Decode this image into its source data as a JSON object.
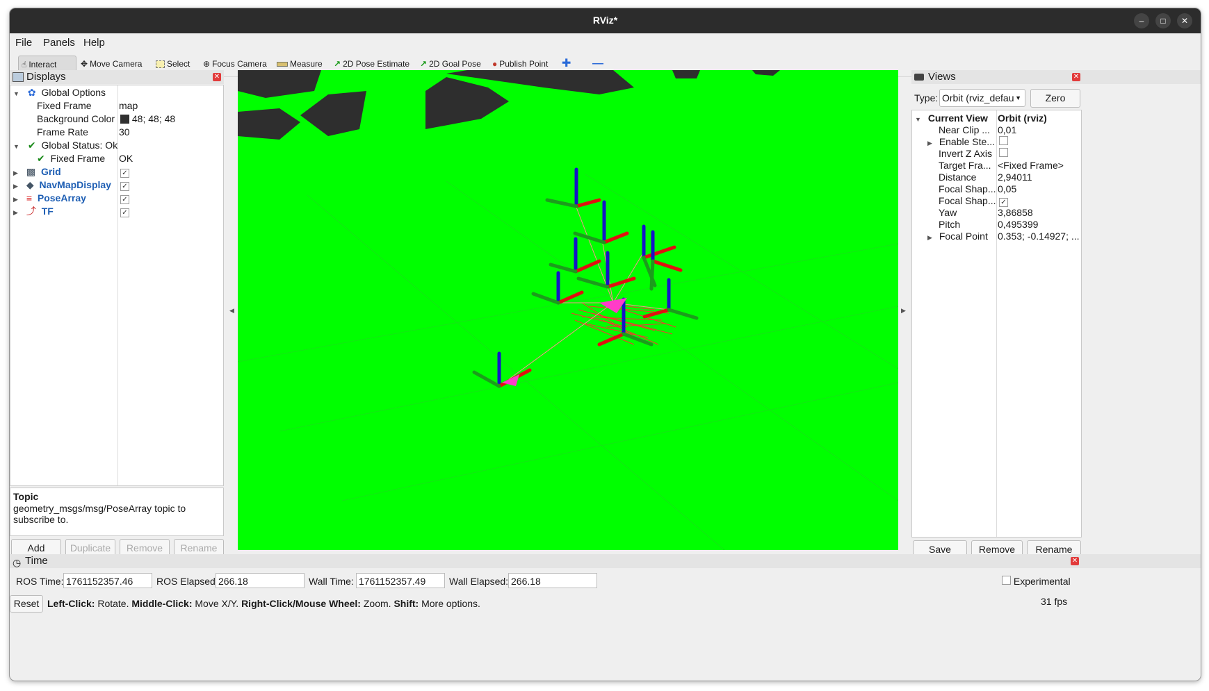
{
  "window": {
    "title": "RViz*"
  },
  "menu": {
    "file": "File",
    "panels": "Panels",
    "help": "Help"
  },
  "toolbar": {
    "interact": "Interact",
    "move_camera": "Move Camera",
    "select": "Select",
    "focus_camera": "Focus Camera",
    "measure": "Measure",
    "pose_estimate": "2D Pose Estimate",
    "goal_pose": "2D Goal Pose",
    "publish_point": "Publish Point"
  },
  "displays": {
    "title": "Displays",
    "global_options": "Global Options",
    "fixed_frame_label": "Fixed Frame",
    "fixed_frame_value": "map",
    "bg_color_label": "Background Color",
    "bg_color_value": "48; 48; 48",
    "frame_rate_label": "Frame Rate",
    "frame_rate_value": "30",
    "global_status": "Global Status: Ok",
    "status_fixed_frame": "Fixed Frame",
    "status_fixed_frame_value": "OK",
    "items": [
      "Grid",
      "NavMapDisplay",
      "PoseArray",
      "TF"
    ],
    "help_title": "Topic",
    "help_text": "geometry_msgs/msg/PoseArray topic to subscribe to.",
    "buttons": {
      "add": "Add",
      "duplicate": "Duplicate",
      "remove": "Remove",
      "rename": "Rename"
    }
  },
  "views": {
    "title": "Views",
    "type_label": "Type:",
    "type_value": "Orbit (rviz_defau",
    "zero": "Zero",
    "current_view": "Current View",
    "current_view_value": "Orbit (rviz)",
    "props": [
      {
        "label": "Near Clip ...",
        "value": "0,01"
      },
      {
        "label": "Enable Ste...",
        "value": ""
      },
      {
        "label": "Invert Z Axis",
        "value": ""
      },
      {
        "label": "Target Fra...",
        "value": "<Fixed Frame>"
      },
      {
        "label": "Distance",
        "value": "2,94011"
      },
      {
        "label": "Focal Shap...",
        "value": "0,05"
      },
      {
        "label": "Focal Shap...",
        "value": ""
      },
      {
        "label": "Yaw",
        "value": "3,86858"
      },
      {
        "label": "Pitch",
        "value": "0,495399"
      },
      {
        "label": "Focal Point",
        "value": "0.353; -0.14927; ..."
      }
    ],
    "buttons": {
      "save": "Save",
      "remove": "Remove",
      "rename": "Rename"
    }
  },
  "time": {
    "title": "Time",
    "ros_time_label": "ROS Time:",
    "ros_time": "1761152357.46",
    "ros_elapsed_label": "ROS Elapsed:",
    "ros_elapsed": "266.18",
    "wall_time_label": "Wall Time:",
    "wall_time": "1761152357.49",
    "wall_elapsed_label": "Wall Elapsed:",
    "wall_elapsed": "266.18",
    "experimental": "Experimental"
  },
  "status": {
    "reset": "Reset",
    "h1": "Left-Click:",
    "t1": " Rotate.",
    "h2": "Middle-Click:",
    "t2": " Move X/Y.",
    "h3": "Right-Click/Mouse Wheel:",
    "t3": " Zoom.",
    "h4": "Shift:",
    "t4": " More options.",
    "fps": "31 fps"
  },
  "colors": {
    "viewport_bg": "#00ff00",
    "obstacle": "#2e2e2e",
    "axis_red": "#e01010",
    "axis_green": "#1c9c1c",
    "axis_blue": "#1414c8"
  }
}
